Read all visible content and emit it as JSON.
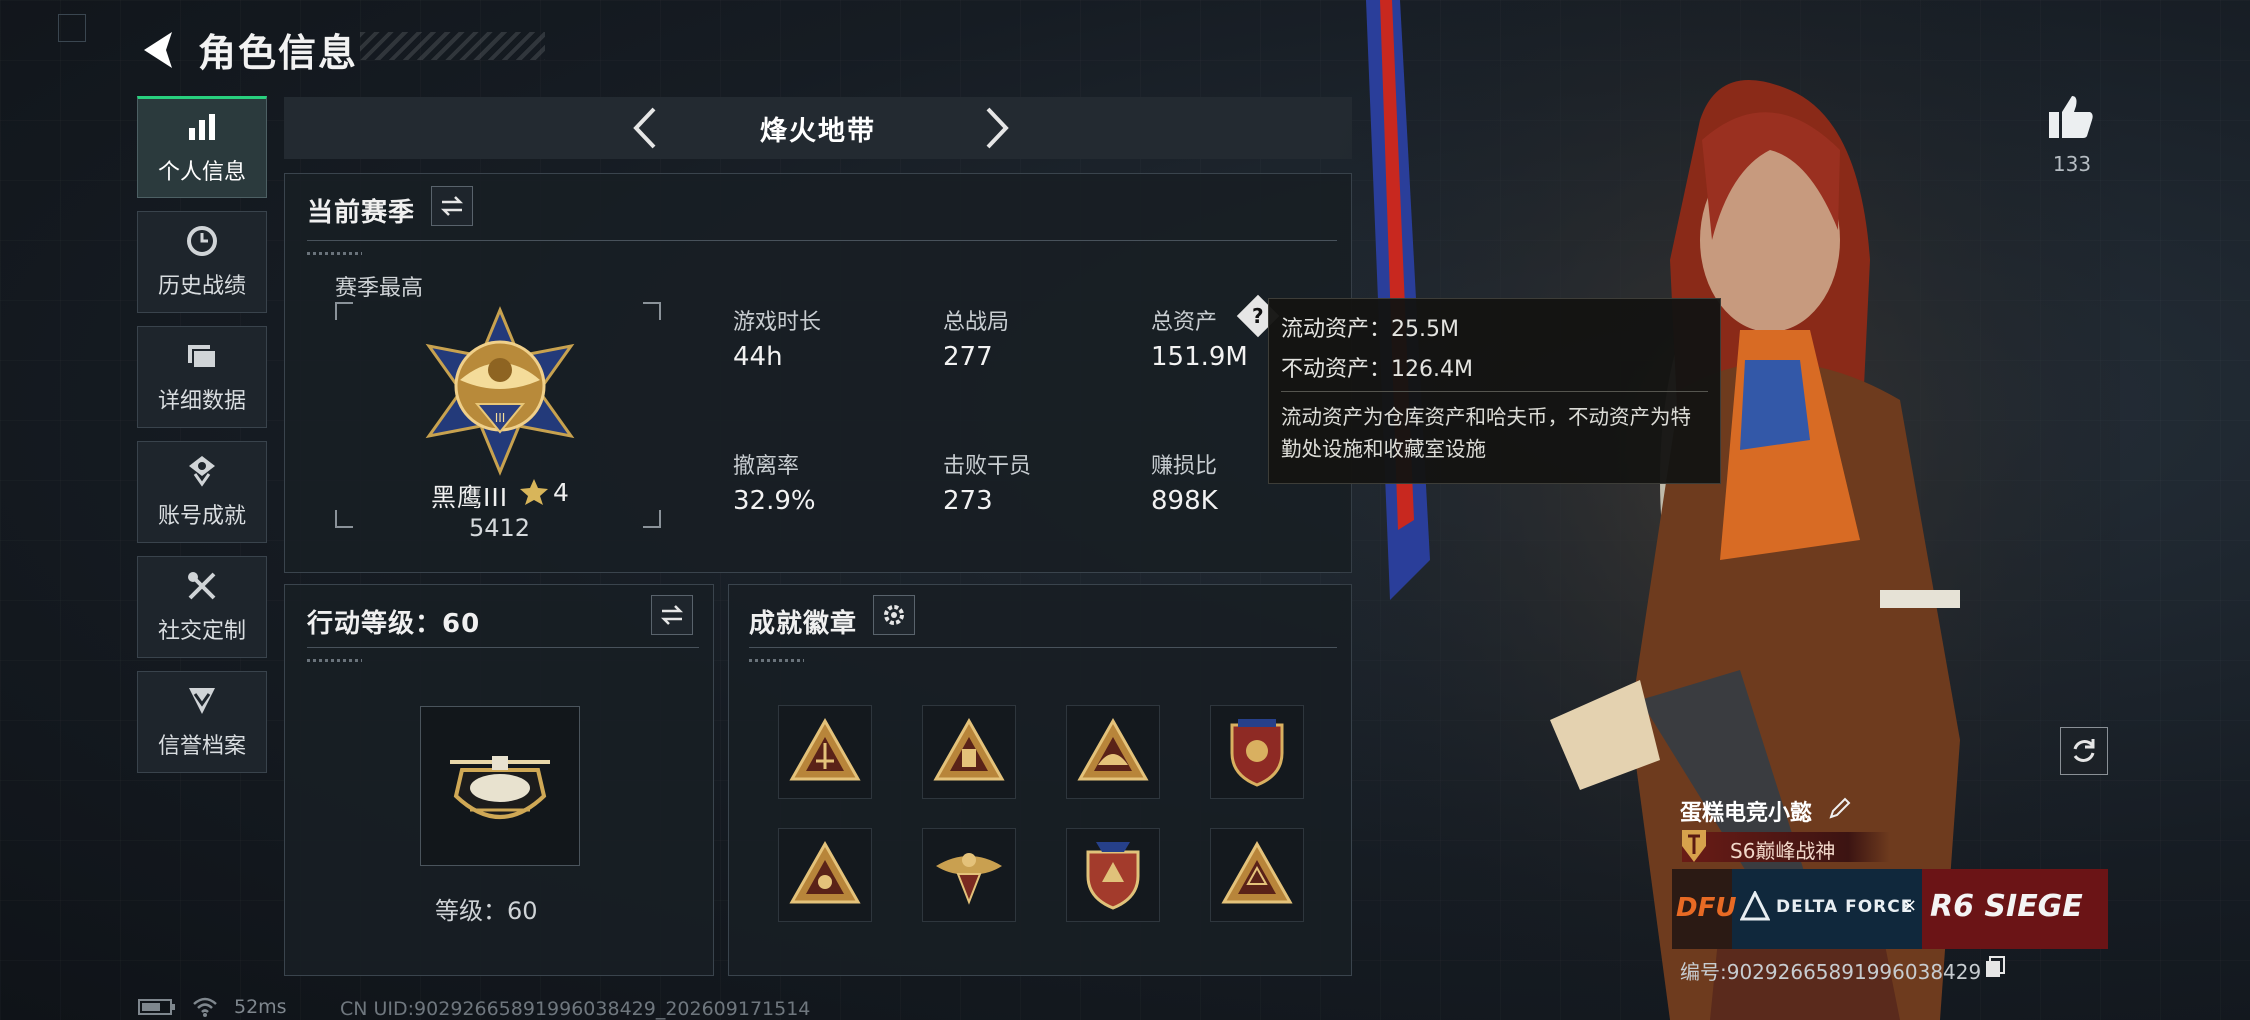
{
  "header": {
    "title": "角色信息"
  },
  "sidebar": {
    "items": [
      {
        "label": "个人信息",
        "icon": "bar-chart-icon",
        "active": true
      },
      {
        "label": "历史战绩",
        "icon": "history-clock-icon"
      },
      {
        "label": "详细数据",
        "icon": "folder-stack-icon"
      },
      {
        "label": "账号成就",
        "icon": "achievement-medal-icon"
      },
      {
        "label": "社交定制",
        "icon": "tools-icon"
      },
      {
        "label": "信誉档案",
        "icon": "shield-chevron-icon"
      }
    ]
  },
  "mode_selector": {
    "current": "烽火地带"
  },
  "season": {
    "title": "当前赛季",
    "best_label": "赛季最高",
    "rank_name": "黑鹰III",
    "rank_stars": "4",
    "rank_points": "5412",
    "stats": [
      {
        "label": "游戏时长",
        "value": "44h"
      },
      {
        "label": "总战局",
        "value": "277"
      },
      {
        "label": "总资产",
        "value": "151.9M"
      },
      {
        "label": "撤离率",
        "value": "32.9%"
      },
      {
        "label": "击败干员",
        "value": "273"
      },
      {
        "label": "赚损比",
        "value": "898K"
      }
    ]
  },
  "tooltip": {
    "liquid": "流动资产：25.5M",
    "fixed": "不动资产：126.4M",
    "desc": "流动资产为仓库资产和哈夫币，不动资产为特勤处设施和收藏室设施"
  },
  "action_level": {
    "title": "行动等级：60",
    "level_text": "等级：60"
  },
  "badges": {
    "title": "成就徽章"
  },
  "profile": {
    "likes": "133",
    "player_name": "蛋糕电竞小懿",
    "title_tag": "S6巅峰战神",
    "banner_left": "DFU",
    "banner_mid": "DELTA FORCE",
    "banner_x": "×",
    "banner_right": "R6 SIEGE",
    "uid": "编号:90292665891996038429"
  },
  "status_bar": {
    "ping": "52ms",
    "cn_uid": "CN UID:90292665891996038429_202609171514"
  },
  "colors": {
    "accent_green": "#28d07e",
    "panel_bg": "#181e24",
    "tag_red": "#6a1b16"
  }
}
